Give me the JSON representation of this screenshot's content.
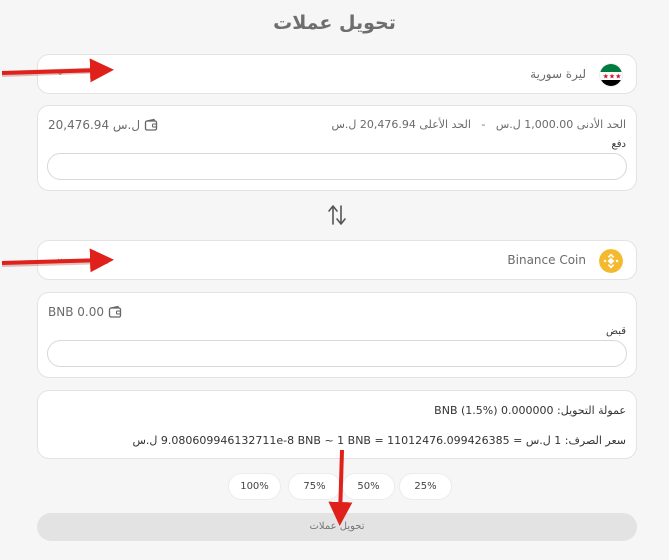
{
  "page": {
    "title": "تحويل عملات"
  },
  "send": {
    "currency_name": "ليرة سورية",
    "flag_icon": "syria-flag-icon",
    "balance": "20,476.94 ل.س",
    "min_limit": "الحد الأدنى 1,000.00 ل.س",
    "separator": "-",
    "max_limit": "الحد الأعلى 20,476.94 ل.س",
    "field_label": "دفع",
    "input_value": "",
    "input_placeholder": ""
  },
  "receive": {
    "currency_name": "Binance Coin",
    "coin_icon": "bnb-icon",
    "balance": "BNB 0.00",
    "field_label": "قبض",
    "input_value": "",
    "input_placeholder": ""
  },
  "info": {
    "commission": "عمولة التحويل: 0.000000 BNB (1.5%)",
    "rate": "سعر الصرف: 1 ل.س = 9.080609946132711e-8 BNB ~ 1 BNB = 11012476.099426385 ل.س"
  },
  "percent_buttons": [
    "25%",
    "50%",
    "75%",
    "100%"
  ],
  "submit_label": "تحويل عملات",
  "colors": {
    "bnb": "#F3BA2F",
    "syria_green": "#007A3D",
    "syria_red": "#CE1126",
    "annotation_arrow": "#E0201B"
  }
}
